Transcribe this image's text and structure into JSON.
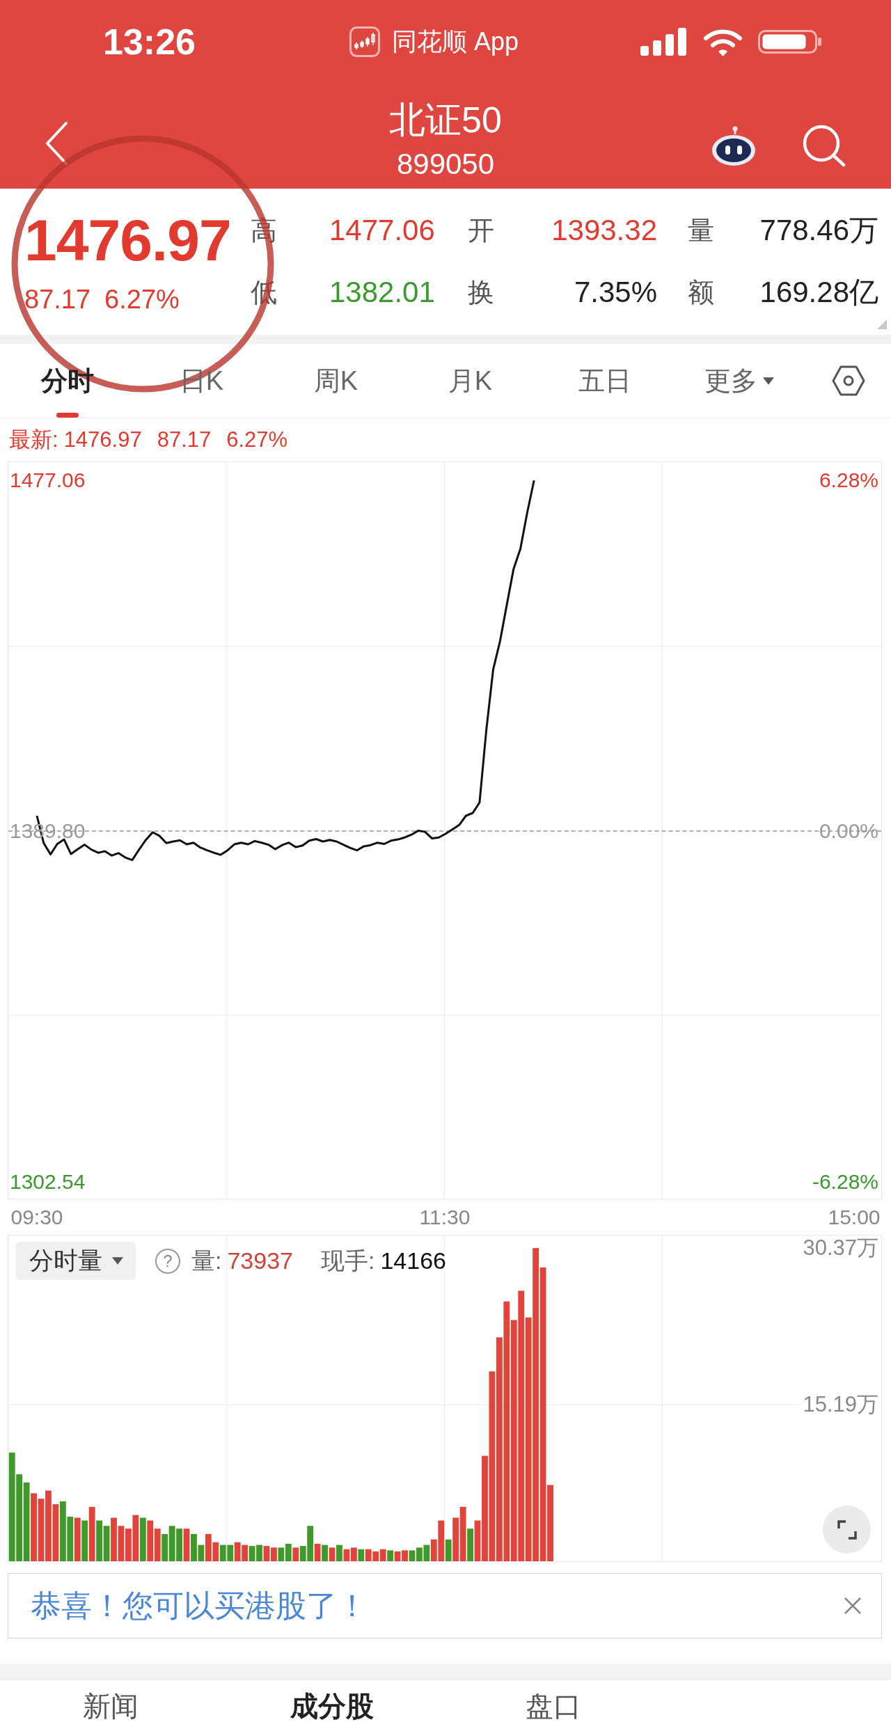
{
  "status_bar": {
    "time": "13:26",
    "app_name": "同花顺 App"
  },
  "nav": {
    "title": "北证50",
    "code": "899050"
  },
  "highlight": {
    "kind": "ellipse"
  },
  "quote": {
    "price": "1476.97",
    "change": "87.17",
    "percent": "6.27%",
    "stats": [
      {
        "label": "高",
        "value": "1477.06",
        "color": "#e23a2e"
      },
      {
        "label": "开",
        "value": "1393.32",
        "color": "#e23a2e"
      },
      {
        "label": "量",
        "value": "778.46万",
        "color": "#222222"
      },
      {
        "label": "低",
        "value": "1382.01",
        "color": "#3a9a2e"
      },
      {
        "label": "换",
        "value": "7.35%",
        "color": "#222222"
      },
      {
        "label": "额",
        "value": "169.28亿",
        "color": "#222222"
      }
    ]
  },
  "tabs": [
    {
      "label": "分时",
      "kind": "tab",
      "selected": true
    },
    {
      "label": "日K",
      "kind": "tab",
      "selected": false
    },
    {
      "label": "周K",
      "kind": "tab",
      "selected": false
    },
    {
      "label": "月K",
      "kind": "tab",
      "selected": false
    },
    {
      "label": "五日",
      "kind": "tab",
      "selected": false
    },
    {
      "label": "更多",
      "kind": "dropdown",
      "selected": false
    }
  ],
  "price_chart": {
    "latest": {
      "label": "最新:",
      "price": "1476.97",
      "change": "87.17",
      "percent": "6.27%"
    },
    "right_axis_labels": [
      "6.28%",
      "0.00%",
      "-6.28%"
    ],
    "chart_data": {
      "type": "line",
      "categories": [
        "09:30",
        null,
        null,
        null,
        null,
        null,
        null,
        null,
        null,
        null,
        null,
        null,
        null,
        null,
        null,
        null,
        null,
        null,
        null,
        null,
        null,
        null,
        null,
        null,
        null,
        null,
        null,
        null,
        null,
        null,
        null,
        null,
        null,
        null,
        null,
        null,
        null,
        null,
        null,
        null,
        null,
        null,
        null,
        null,
        null,
        null,
        null,
        null,
        null,
        null,
        null,
        null,
        null,
        null,
        null,
        null,
        null,
        null,
        null,
        null,
        "11:30",
        null,
        null,
        null,
        null,
        null,
        null,
        null,
        null,
        null,
        null,
        null,
        null,
        null,
        null,
        null,
        null,
        null,
        null,
        null,
        null,
        null,
        null,
        null,
        null,
        null,
        null,
        null,
        null,
        null,
        null,
        null,
        null,
        null,
        null,
        null,
        null,
        null,
        null,
        null,
        null,
        null,
        null,
        null,
        null,
        null,
        null,
        null,
        null,
        null,
        null,
        null,
        null,
        null,
        null,
        null,
        null,
        null,
        null,
        null,
        "15:00"
      ],
      "series": [
        {
          "color": "#111111",
          "values": [
            1393.6,
            1386.8,
            1384.0,
            1386.6,
            1387.7,
            1384.1,
            1385.3,
            1386.4,
            1385.2,
            1384.4,
            1384.8,
            1383.7,
            1384.3,
            1383.2,
            1382.6,
            1385.2,
            1387.6,
            1389.5,
            1388.6,
            1386.8,
            1387.2,
            1387.5,
            1386.5,
            1386.9,
            1385.7,
            1385.0,
            1384.4,
            1383.9,
            1385.0,
            1386.5,
            1386.9,
            1386.5,
            1387.3,
            1386.9,
            1386.4,
            1385.3,
            1386.3,
            1386.9,
            1385.8,
            1386.2,
            1387.4,
            1387.8,
            1387.2,
            1387.6,
            1387.2,
            1386.4,
            1385.6,
            1385.0,
            1386.0,
            1386.3,
            1386.9,
            1386.6,
            1387.4,
            1387.7,
            1388.2,
            1388.9,
            1389.9,
            1389.6,
            1388.0,
            1388.2,
            1389.1,
            1390.2,
            1391.3,
            1393.6,
            1394.3,
            1396.9,
            1415.0,
            1430.0,
            1437.0,
            1446.0,
            1455.0,
            1460.0,
            1469.0,
            1477.0,
            null,
            null,
            null,
            null,
            null,
            null,
            null,
            null,
            null,
            null,
            null,
            null,
            null,
            null,
            null,
            null,
            null,
            null,
            null,
            null,
            null,
            null,
            null,
            null,
            null,
            null,
            null,
            null,
            null,
            null,
            null,
            null,
            null,
            null,
            null,
            null,
            null,
            null,
            null,
            null,
            null,
            null,
            null,
            null,
            null,
            null,
            null
          ]
        }
      ],
      "ylim": [
        1298.38,
        1481.56
      ],
      "yticks": [
        {
          "value": 1302.54,
          "label": "1302.54"
        },
        {
          "value": 1389.8,
          "label": "1389.80"
        },
        {
          "value": 1477.06,
          "label": "1477.06"
        }
      ]
    }
  },
  "volume_chart": {
    "selector": "分时量",
    "help": "?",
    "volume_label": "量:",
    "volume": "73937",
    "hand_label": "现手:",
    "hand": "14166",
    "chart_data": {
      "type": "bar",
      "ylim": [
        0,
        31.59
      ],
      "yticks": [
        {
          "value": 15.19,
          "label": "15.19万"
        },
        {
          "value": 30.37,
          "label": "30.37万"
        }
      ],
      "series": [
        {
          "color": "#e0443a",
          "values": [
            null,
            null,
            null,
            6.59,
            6.06,
            6.85,
            5.53,
            null,
            null,
            4.22,
            null,
            5.27,
            null,
            null,
            4.22,
            3.43,
            3.16,
            4.48,
            null,
            3.95,
            3.16,
            null,
            null,
            null,
            3.16,
            null,
            null,
            2.64,
            1.84,
            null,
            null,
            1.84,
            1.58,
            null,
            null,
            1.48,
            1.32,
            null,
            null,
            1.32,
            null,
            null,
            1.69,
            null,
            1.32,
            null,
            1.16,
            1.32,
            null,
            1.16,
            0.95,
            1.16,
            null,
            0.95,
            1.05,
            null,
            null,
            null,
            2.11,
            3.95,
            null,
            4.22,
            5.27,
            null,
            3.95,
            10.22,
            18.41,
            21.71,
            25.19,
            23.39,
            26.23,
            23.64,
            30.37,
            28.49,
            7.39,
            null,
            null,
            null,
            null,
            null,
            null,
            null,
            null,
            null,
            null,
            null,
            null,
            null,
            null,
            null,
            null,
            null,
            null,
            null,
            null,
            null,
            null,
            null,
            null,
            null,
            null,
            null,
            null,
            null,
            null,
            null,
            null,
            null,
            null,
            null,
            null,
            null,
            null,
            null,
            null,
            null,
            null,
            null,
            null,
            null
          ]
        },
        {
          "color": "#3f9a2a",
          "values": [
            10.54,
            8.43,
            7.64,
            null,
            null,
            null,
            null,
            5.8,
            4.32,
            null,
            3.95,
            null,
            3.95,
            3.43,
            null,
            null,
            null,
            null,
            4.22,
            null,
            null,
            2.64,
            3.43,
            3.16,
            null,
            2.64,
            1.58,
            null,
            null,
            1.58,
            1.58,
            null,
            null,
            1.48,
            1.58,
            null,
            null,
            1.32,
            1.69,
            null,
            1.48,
            3.43,
            null,
            1.58,
            null,
            1.58,
            null,
            null,
            1.16,
            null,
            null,
            null,
            1.05,
            null,
            null,
            1.05,
            1.32,
            1.58,
            null,
            null,
            2.11,
            null,
            null,
            3.16,
            null,
            null,
            null,
            null,
            null,
            null,
            null,
            null,
            null,
            null,
            null,
            null,
            null,
            null,
            null,
            null,
            null,
            null,
            null,
            null,
            null,
            null,
            null,
            null,
            null,
            null,
            null,
            null,
            null,
            null,
            null,
            null,
            null,
            null,
            null,
            null,
            null,
            null,
            null,
            null,
            null,
            null,
            null,
            null,
            null,
            null,
            null,
            null,
            null,
            null,
            null,
            null,
            null,
            null,
            null,
            null
          ]
        }
      ]
    }
  },
  "banner": {
    "text": "恭喜！您可以买港股了！"
  },
  "bottom_tabs": [
    {
      "label": "新闻",
      "selected": false
    },
    {
      "label": "成分股",
      "selected": true
    },
    {
      "label": "盘口",
      "selected": false
    }
  ]
}
